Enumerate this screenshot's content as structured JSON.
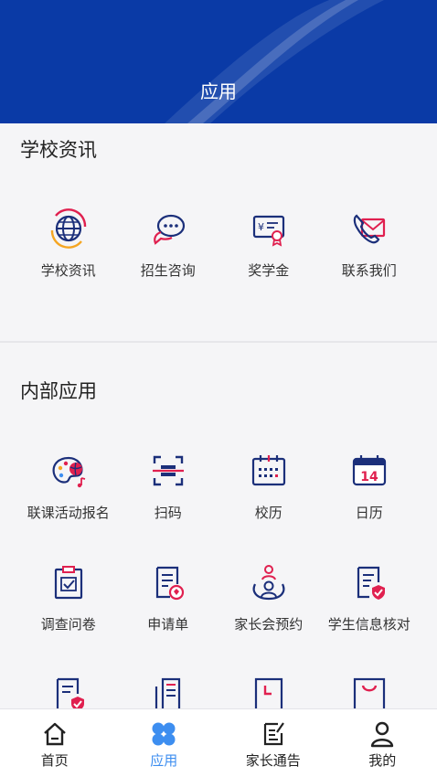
{
  "header": {
    "title": "应用"
  },
  "section_news": {
    "title": "学校资讯",
    "items": [
      {
        "label": "学校资讯",
        "icon": "globe-icon"
      },
      {
        "label": "招生咨询",
        "icon": "chat-bubble-icon"
      },
      {
        "label": "奖学金",
        "icon": "certificate-icon"
      },
      {
        "label": "联系我们",
        "icon": "phone-mail-icon"
      }
    ]
  },
  "section_internal": {
    "title": "内部应用",
    "row1": [
      {
        "label": "联课活动报名",
        "icon": "palette-ball-icon"
      },
      {
        "label": "扫码",
        "icon": "scan-icon"
      },
      {
        "label": "校历",
        "icon": "school-calendar-icon"
      },
      {
        "label": "日历",
        "icon": "calendar-icon"
      }
    ],
    "row2": [
      {
        "label": "调查问卷",
        "icon": "clipboard-check-icon"
      },
      {
        "label": "申请单",
        "icon": "application-form-icon"
      },
      {
        "label": "家长会预约",
        "icon": "parent-meeting-icon"
      },
      {
        "label": "学生信息核对",
        "icon": "verify-document-icon"
      }
    ],
    "calendar_day": "14"
  },
  "tabbar": {
    "items": [
      {
        "label": "首页",
        "icon": "home-icon"
      },
      {
        "label": "应用",
        "icon": "apps-icon"
      },
      {
        "label": "家长通告",
        "icon": "notice-icon"
      },
      {
        "label": "我的",
        "icon": "profile-icon"
      }
    ]
  },
  "colors": {
    "header_blue": "#0a3aa6",
    "icon_navy": "#1b2f7a",
    "icon_red": "#e0204f",
    "tab_active": "#3d8ef0"
  }
}
